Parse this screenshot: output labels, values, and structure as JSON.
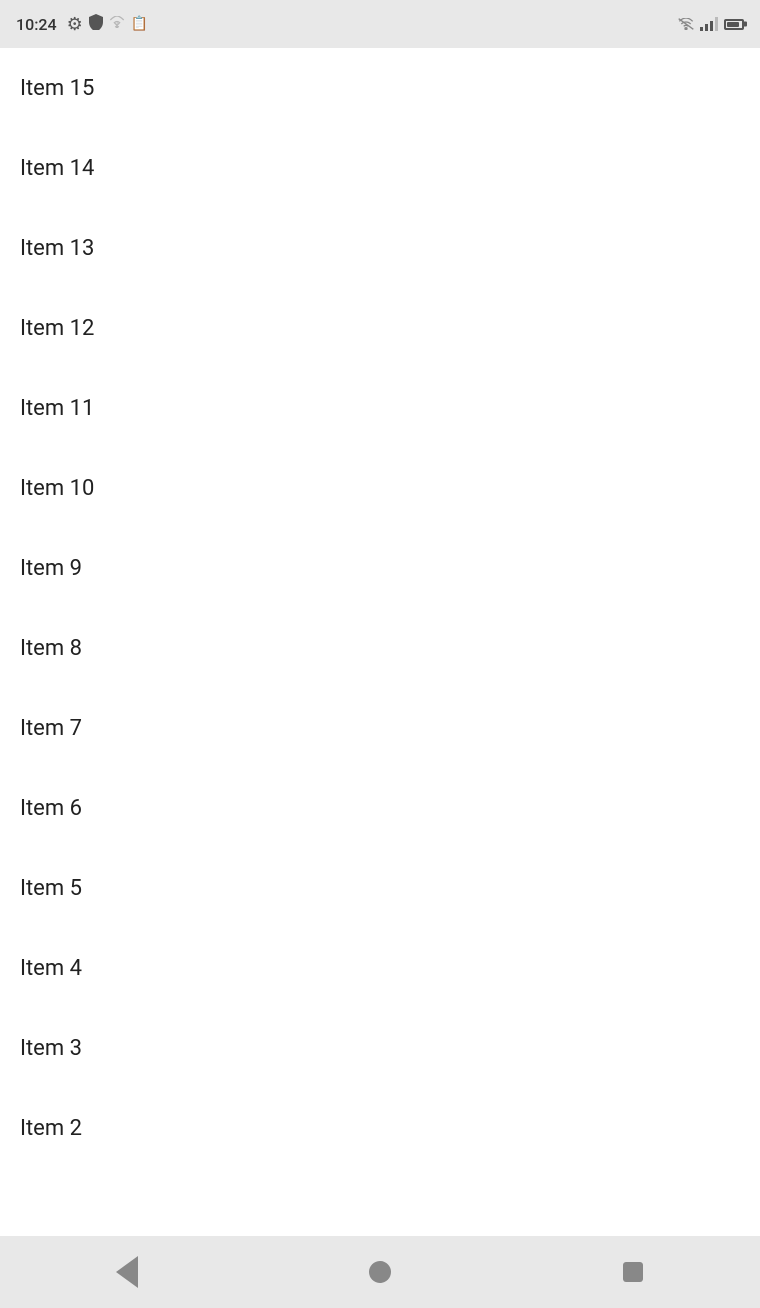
{
  "statusBar": {
    "time": "10:24",
    "icons": {
      "gear": "⚙",
      "shield": "🛡",
      "wifi": "wifi",
      "signal": "signal",
      "battery": "battery"
    }
  },
  "list": {
    "items": [
      {
        "id": 15,
        "label": "Item 15"
      },
      {
        "id": 14,
        "label": "Item 14"
      },
      {
        "id": 13,
        "label": "Item 13"
      },
      {
        "id": 12,
        "label": "Item 12"
      },
      {
        "id": 11,
        "label": "Item 11"
      },
      {
        "id": 10,
        "label": "Item 10"
      },
      {
        "id": 9,
        "label": "Item 9"
      },
      {
        "id": 8,
        "label": "Item 8"
      },
      {
        "id": 7,
        "label": "Item 7"
      },
      {
        "id": 6,
        "label": "Item 6"
      },
      {
        "id": 5,
        "label": "Item 5"
      },
      {
        "id": 4,
        "label": "Item 4"
      },
      {
        "id": 3,
        "label": "Item 3"
      },
      {
        "id": 2,
        "label": "Item 2"
      }
    ]
  },
  "navBar": {
    "back": "back",
    "home": "home",
    "recent": "recent"
  }
}
